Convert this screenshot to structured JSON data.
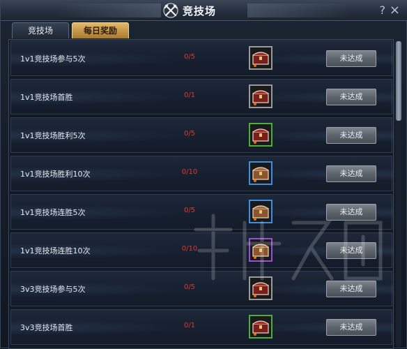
{
  "window": {
    "title": "竞技场",
    "help_label": "?",
    "close_label": "×"
  },
  "tabs": [
    {
      "label": "竞技场",
      "active": false
    },
    {
      "label": "每日奖励",
      "active": true
    }
  ],
  "tasks": [
    {
      "name": "1v1竞技场参与5次",
      "progress": "0/5",
      "reward_rarity": "white",
      "status": "未达成"
    },
    {
      "name": "1v1竞技场首胜",
      "progress": "0/1",
      "reward_rarity": "white",
      "status": "未达成"
    },
    {
      "name": "1v1竞技场胜利5次",
      "progress": "0/5",
      "reward_rarity": "green",
      "status": "未达成"
    },
    {
      "name": "1v1竞技场胜利10次",
      "progress": "0/10",
      "reward_rarity": "blue",
      "status": "未达成"
    },
    {
      "name": "1v1竞技场连胜5次",
      "progress": "0/5",
      "reward_rarity": "blue",
      "status": "未达成"
    },
    {
      "name": "1v1竞技场连胜10次",
      "progress": "0/10",
      "reward_rarity": "purple",
      "status": "未达成"
    },
    {
      "name": "3v3竞技场参与5次",
      "progress": "0/5",
      "reward_rarity": "white",
      "status": "未达成"
    },
    {
      "name": "3v3竞技场首胜",
      "progress": "0/1",
      "reward_rarity": "green",
      "status": "未达成"
    }
  ],
  "colors": {
    "progress_text": "#e03a2a",
    "rarity_white": "#9a9a9a",
    "rarity_green": "#4caf3c",
    "rarity_blue": "#3d8fe0",
    "rarity_purple": "#9b4fd6",
    "tab_active": "#d9ab5a"
  },
  "icons": {
    "title": "crossed-swords-icon",
    "reward": "treasure-chest-icon"
  },
  "scroll": {
    "position_fraction": 0.0,
    "visible_fraction": 0.26
  }
}
